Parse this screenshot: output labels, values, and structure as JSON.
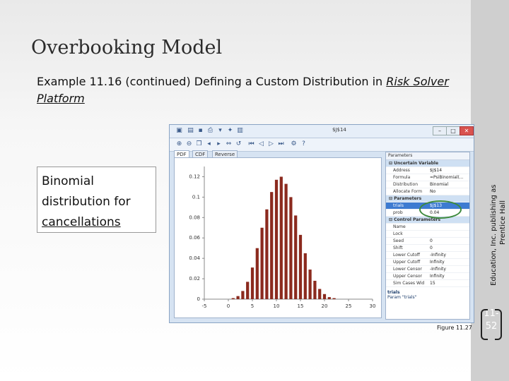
{
  "slide": {
    "title": "Overbooking Model",
    "subtitle_main": "Example 11.16 (continued) Defining a Custom Distribution in ",
    "subtitle_underlined": "Risk Solver Platform",
    "callout_line1": "Binomial",
    "callout_line2": "distribution for",
    "callout_line3": "cancellations",
    "figure_label": "Figure 11.27",
    "side_text_line1": "Education, Inc. publishing as",
    "side_text_line2": "Prentice Hall",
    "page_number_line1": "11-",
    "page_number_line2": "52"
  },
  "app": {
    "cell_ref": "$J$14",
    "tabs": [
      "PDF",
      "CDF",
      "Reverse CDF"
    ],
    "panel_dropdown": "Parameters",
    "properties": [
      {
        "type": "section",
        "label": "Uncertain Variable"
      },
      {
        "type": "row",
        "key": "Address",
        "value": "$J$14"
      },
      {
        "type": "row",
        "key": "Formula",
        "value": "=PsiBinomial(..."
      },
      {
        "type": "row",
        "key": "Distribution",
        "value": "Binomial"
      },
      {
        "type": "row",
        "key": "Allocate Form",
        "value": "No"
      },
      {
        "type": "section",
        "label": "Parameters"
      },
      {
        "type": "sel",
        "key": "trials",
        "value": "$J$13"
      },
      {
        "type": "row",
        "key": "prob",
        "value": "0.04"
      },
      {
        "type": "section",
        "label": "Control Parameters"
      },
      {
        "type": "row",
        "key": "Name",
        "value": ""
      },
      {
        "type": "row",
        "key": "Lock",
        "value": ""
      },
      {
        "type": "row",
        "key": "Seed",
        "value": "0"
      },
      {
        "type": "row",
        "key": "Shift",
        "value": "0"
      },
      {
        "type": "row",
        "key": "Lower Cutoff",
        "value": "-Infinity"
      },
      {
        "type": "row",
        "key": "Upper Cutoff",
        "value": "Infinity"
      },
      {
        "type": "row",
        "key": "Lower Censor",
        "value": "-Infinity"
      },
      {
        "type": "row",
        "key": "Upper Censor",
        "value": "Infinity"
      },
      {
        "type": "row",
        "key": "Sim Cases Wid",
        "value": "15"
      }
    ],
    "description_title": "trials",
    "description_text": "Param \"trials\""
  },
  "chart_data": {
    "type": "bar",
    "ylim": [
      0,
      0.13
    ],
    "yticks": [
      0,
      0.02,
      0.04,
      0.06,
      0.08,
      0.1,
      0.12
    ],
    "ytick_labels": [
      "0",
      "0.02",
      "0.04",
      "0.06",
      "0.08",
      "0.1",
      "0.12"
    ],
    "xlim": [
      -5,
      30
    ],
    "xticks": [
      -5,
      0,
      5,
      10,
      15,
      20,
      25,
      30
    ],
    "xtick_labels": [
      "-5",
      "0",
      "5",
      "10",
      "15",
      "20",
      "25",
      "30"
    ],
    "x": [
      1,
      2,
      3,
      4,
      5,
      6,
      7,
      8,
      9,
      10,
      11,
      12,
      13,
      14,
      15,
      16,
      17,
      18,
      19,
      20,
      21,
      22
    ],
    "values": [
      0.001,
      0.003,
      0.008,
      0.017,
      0.031,
      0.05,
      0.07,
      0.088,
      0.105,
      0.117,
      0.12,
      0.113,
      0.1,
      0.082,
      0.063,
      0.045,
      0.029,
      0.018,
      0.01,
      0.005,
      0.002,
      0.001
    ],
    "bar_color": "#8b2a1e",
    "grid": false
  }
}
